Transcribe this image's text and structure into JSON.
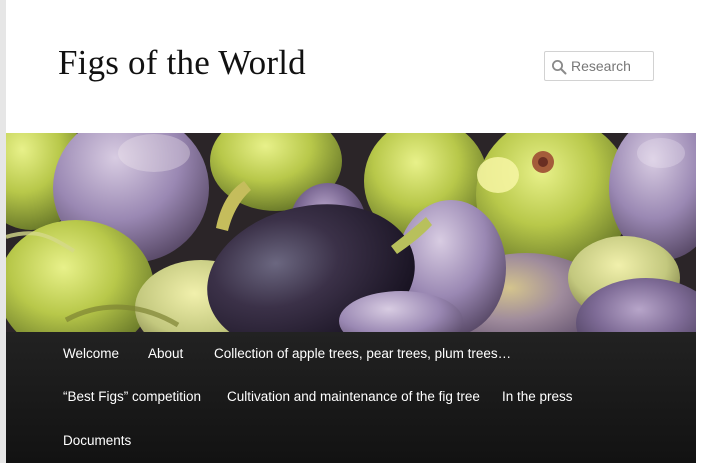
{
  "site": {
    "title": "Figs of the World"
  },
  "search": {
    "placeholder": "Research",
    "icon": "search-icon"
  },
  "colors": {
    "page_background": "#e6e6e6",
    "header_background": "#ffffff",
    "nav_background": "#1a1a1a",
    "nav_text": "#ffffff"
  },
  "nav": {
    "items": [
      {
        "label": "Welcome"
      },
      {
        "label": "About"
      },
      {
        "label": "Collection of apple trees, pear trees, plum trees…"
      },
      {
        "label": "“Best Figs” competition"
      },
      {
        "label": "Cultivation and maintenance of the fig tree"
      },
      {
        "label": "In the press"
      },
      {
        "label": "Documents"
      }
    ]
  }
}
